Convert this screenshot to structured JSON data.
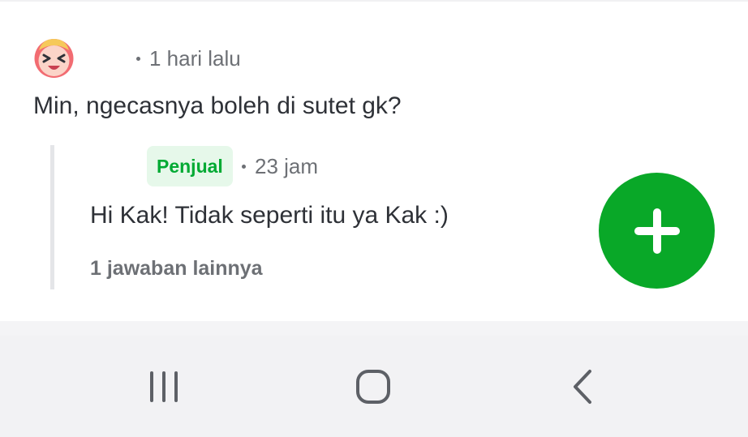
{
  "comment": {
    "time_label": "1 hari lalu",
    "text": "Min, ngecasnya boleh di sutet gk?"
  },
  "reply": {
    "badge_label": "Penjual",
    "time_label": "23 jam",
    "text": "Hi Kak! Tidak seperti itu ya Kak :)",
    "more_replies_label": "1 jawaban lainnya"
  },
  "fab": {
    "icon": "plus-icon",
    "color": "#09a828"
  },
  "navigation": {
    "recents_icon": "recents-icon",
    "home_icon": "home-icon",
    "back_icon": "back-icon"
  },
  "colors": {
    "accent_green": "#00aa33",
    "badge_background": "#e6f8ea",
    "text_primary": "#2e3137",
    "text_secondary": "#6d7075"
  }
}
